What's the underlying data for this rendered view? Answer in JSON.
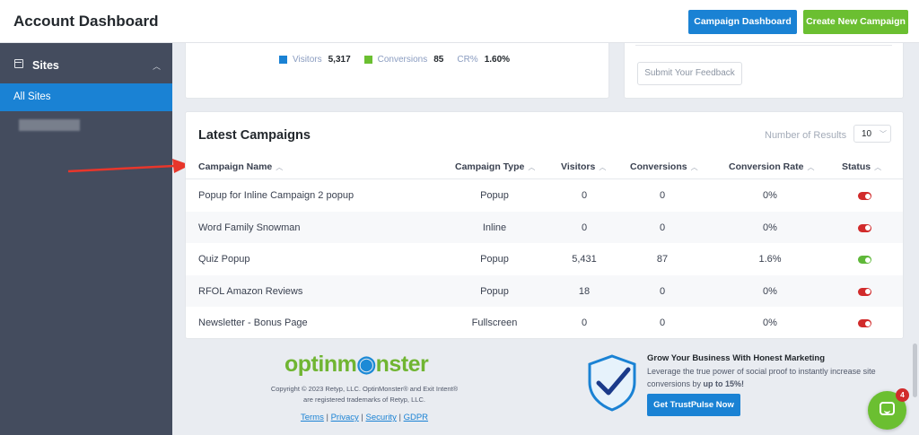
{
  "header": {
    "title": "Account Dashboard",
    "campaign_dashboard_label": "Campaign Dashboard",
    "create_campaign_label": "Create New Campaign"
  },
  "sidebar": {
    "section_label": "Sites",
    "items": [
      {
        "label": "All Sites",
        "active": true
      }
    ]
  },
  "stats": {
    "visitors_label": "Visitors",
    "visitors_value": "5,317",
    "conversions_label": "Conversions",
    "conversions_value": "85",
    "cr_label": "CR%",
    "cr_value": "1.60%",
    "colors": {
      "visitors": "#1a82d4",
      "conversions": "#6bbf31"
    }
  },
  "feedback": {
    "button_label": "Submit Your Feedback"
  },
  "campaigns": {
    "title": "Latest Campaigns",
    "results_label": "Number of Results",
    "results_value": "10",
    "columns": [
      "Campaign Name",
      "Campaign Type",
      "Visitors",
      "Conversions",
      "Conversion Rate",
      "Status"
    ],
    "rows": [
      {
        "name": "Popup for Inline Campaign 2 popup",
        "type": "Popup",
        "visitors": "0",
        "conversions": "0",
        "rate": "0%",
        "status": "off"
      },
      {
        "name": "Word Family Snowman",
        "type": "Inline",
        "visitors": "0",
        "conversions": "0",
        "rate": "0%",
        "status": "off"
      },
      {
        "name": "Quiz Popup",
        "type": "Popup",
        "visitors": "5,431",
        "conversions": "87",
        "rate": "1.6%",
        "status": "on"
      },
      {
        "name": "RFOL Amazon Reviews",
        "type": "Popup",
        "visitors": "18",
        "conversions": "0",
        "rate": "0%",
        "status": "off"
      },
      {
        "name": "Newsletter - Bonus Page",
        "type": "Fullscreen",
        "visitors": "0",
        "conversions": "0",
        "rate": "0%",
        "status": "off"
      }
    ]
  },
  "footer": {
    "logo_part1": "optinm",
    "logo_part2": "nster",
    "copyright_line1": "Copyright © 2023 Retyp, LLC. OptinMonster® and Exit Intent®",
    "copyright_line2": "are registered trademarks of Retyp, LLC.",
    "links": [
      "Terms",
      "Privacy",
      "Security",
      "GDPR"
    ],
    "promo_title": "Grow Your Business With Honest Marketing",
    "promo_text": "Leverage the true power of social proof to instantly increase site conversions by",
    "promo_highlight": "up to 15%!",
    "promo_button": "Get TrustPulse Now"
  },
  "chat": {
    "badge_count": "4"
  }
}
